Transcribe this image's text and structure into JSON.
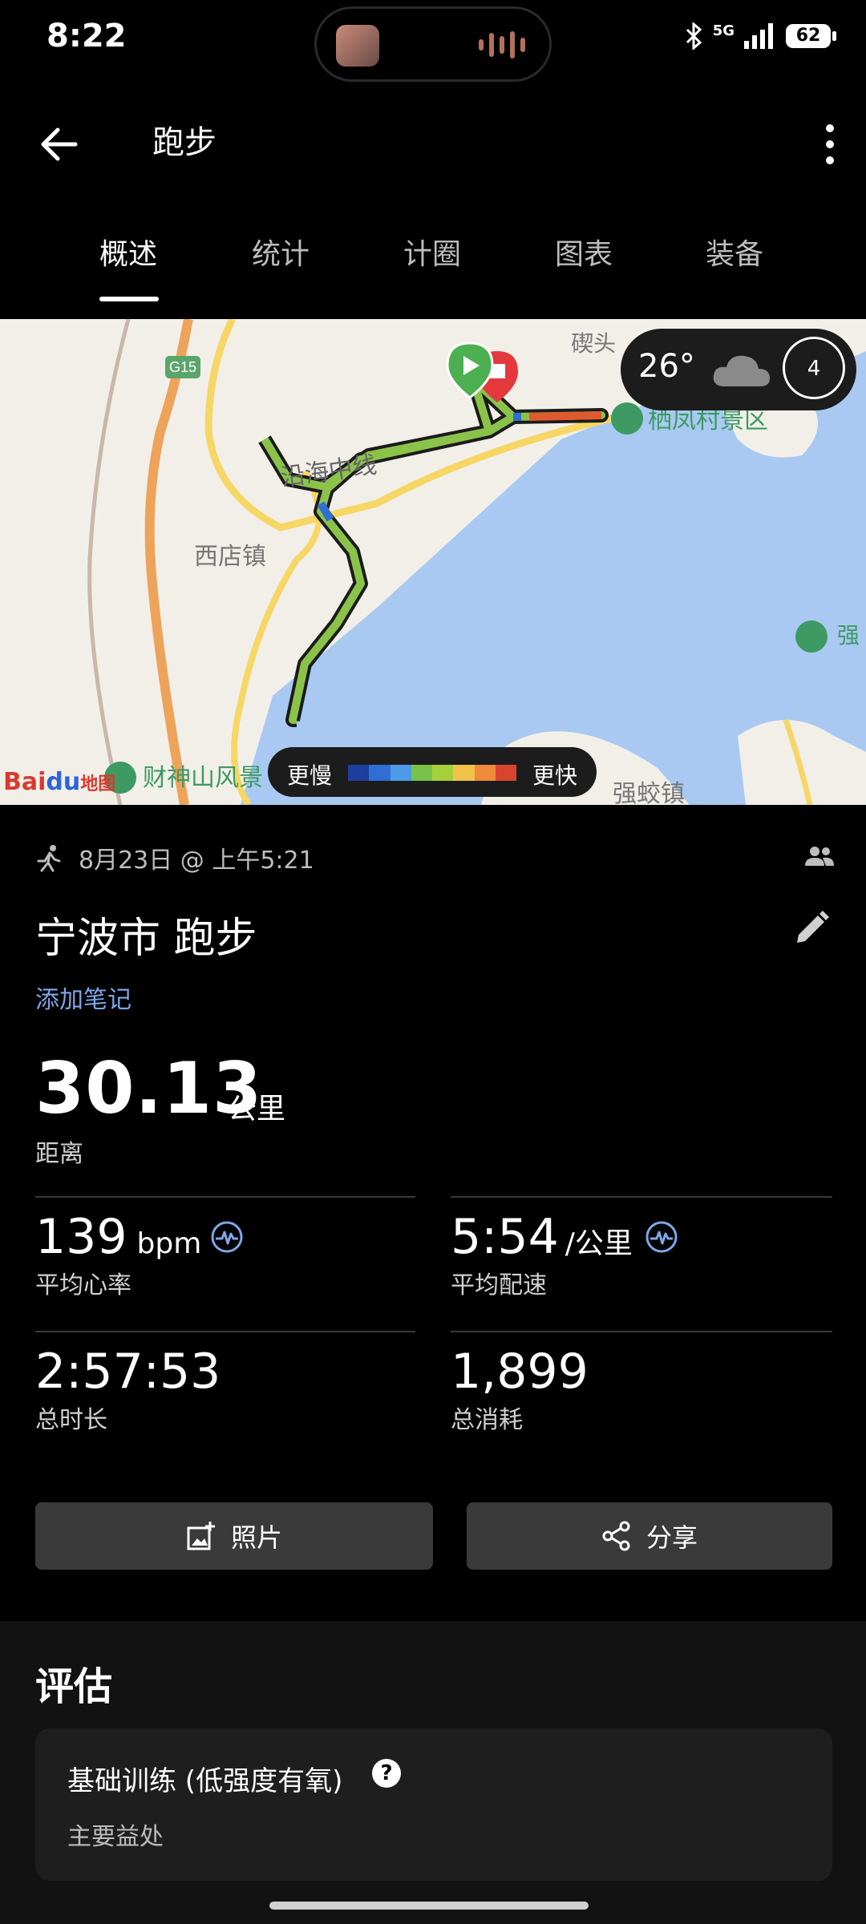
{
  "status_bar": {
    "time": "8:22",
    "network": "5G",
    "battery": "62"
  },
  "header": {
    "title": "跑步"
  },
  "tabs": [
    {
      "label": "概述",
      "active": true
    },
    {
      "label": "统计",
      "active": false
    },
    {
      "label": "计圈",
      "active": false
    },
    {
      "label": "图表",
      "active": false
    },
    {
      "label": "装备",
      "active": false
    }
  ],
  "map": {
    "labels": {
      "highway": "G15",
      "road": "沿海中线",
      "town1": "西店镇",
      "scenic1": "栖凤村景区",
      "scenic2": "财神山风景",
      "town2": "强蛟镇",
      "partial_top": "碶头",
      "partial_right": "强"
    },
    "weather": {
      "temp": "26°",
      "icon": "cloud-icon",
      "wind": "4"
    },
    "legend": {
      "slow": "更慢",
      "fast": "更快",
      "colors": [
        "#1e3f9e",
        "#2f6fd4",
        "#4d9be8",
        "#78c24b",
        "#a6d03b",
        "#f0c24a",
        "#ee8a3a",
        "#d9442f"
      ]
    },
    "provider": {
      "prefix": "Bai",
      "middle": "du",
      "suffix": "地图"
    }
  },
  "activity": {
    "datetime": "8月23日 @ 上午5:21",
    "title": "宁波市 跑步",
    "add_note": "添加笔记",
    "distance": {
      "value": "30.13",
      "unit": "公里",
      "label": "距离"
    },
    "metrics": [
      {
        "value": "139",
        "unit": "bpm",
        "label": "平均心率"
      },
      {
        "value": "5:54",
        "unit": "/公里",
        "label": "平均配速"
      },
      {
        "value": "2:57:53",
        "unit": "",
        "label": "总时长"
      },
      {
        "value": "1,899",
        "unit": "",
        "label": "总消耗"
      }
    ]
  },
  "actions": {
    "photo": "照片",
    "share": "分享"
  },
  "evaluation": {
    "heading": "评估",
    "card_title": "基础训练 (低强度有氧)",
    "card_sub": "主要益处",
    "help": "?"
  },
  "colors": {
    "accent_blue": "#7fa6e8",
    "water": "#a9c9f2",
    "land": "#f2efe9"
  }
}
